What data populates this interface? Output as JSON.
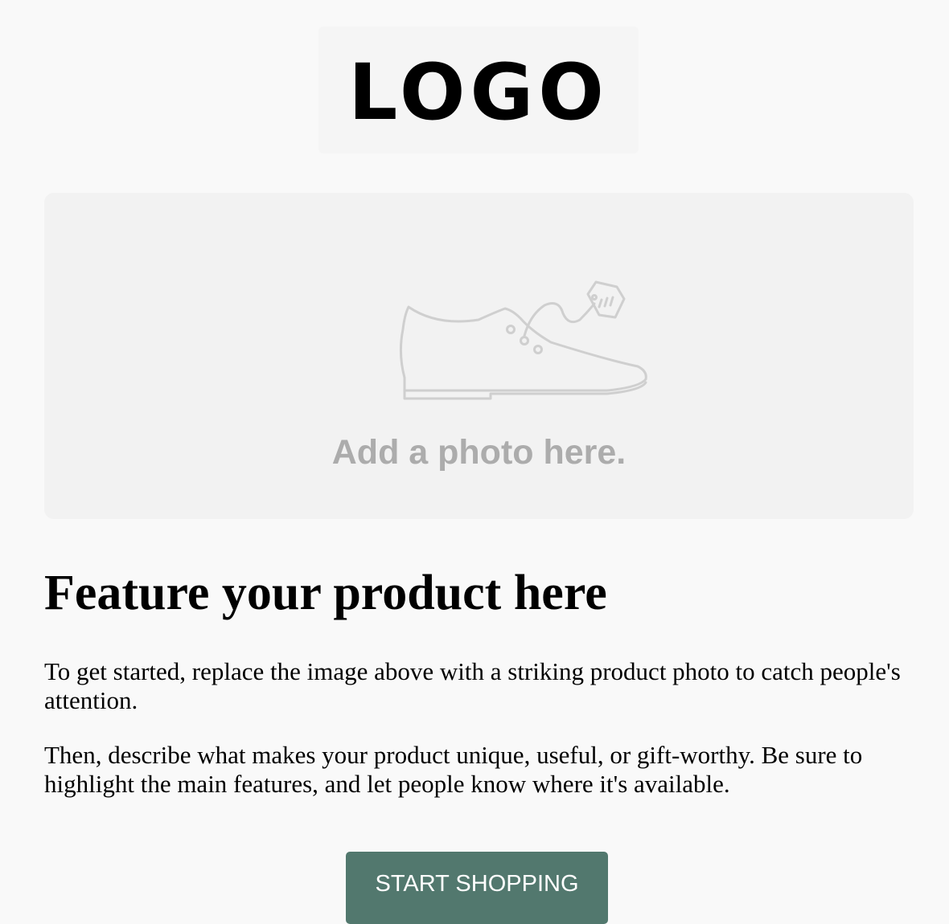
{
  "logo": {
    "text": "LOGO"
  },
  "photo_placeholder": {
    "icon": "shoe-with-tag-icon",
    "caption": "Add a photo here."
  },
  "content": {
    "headline": "Feature your product here",
    "paragraphs": [
      "To get started, replace the image above with a striking product photo to catch people's attention.",
      "Then, describe what makes your product unique, useful, or gift-worthy. Be sure to highlight the main features, and let people know where it's available."
    ]
  },
  "cta": {
    "label": "START SHOPPING",
    "color": "#52786e"
  },
  "colors": {
    "background": "#f9f9f9",
    "placeholder_background": "#f2f2f2",
    "placeholder_text": "#acacac",
    "button_text": "#ffffff"
  }
}
